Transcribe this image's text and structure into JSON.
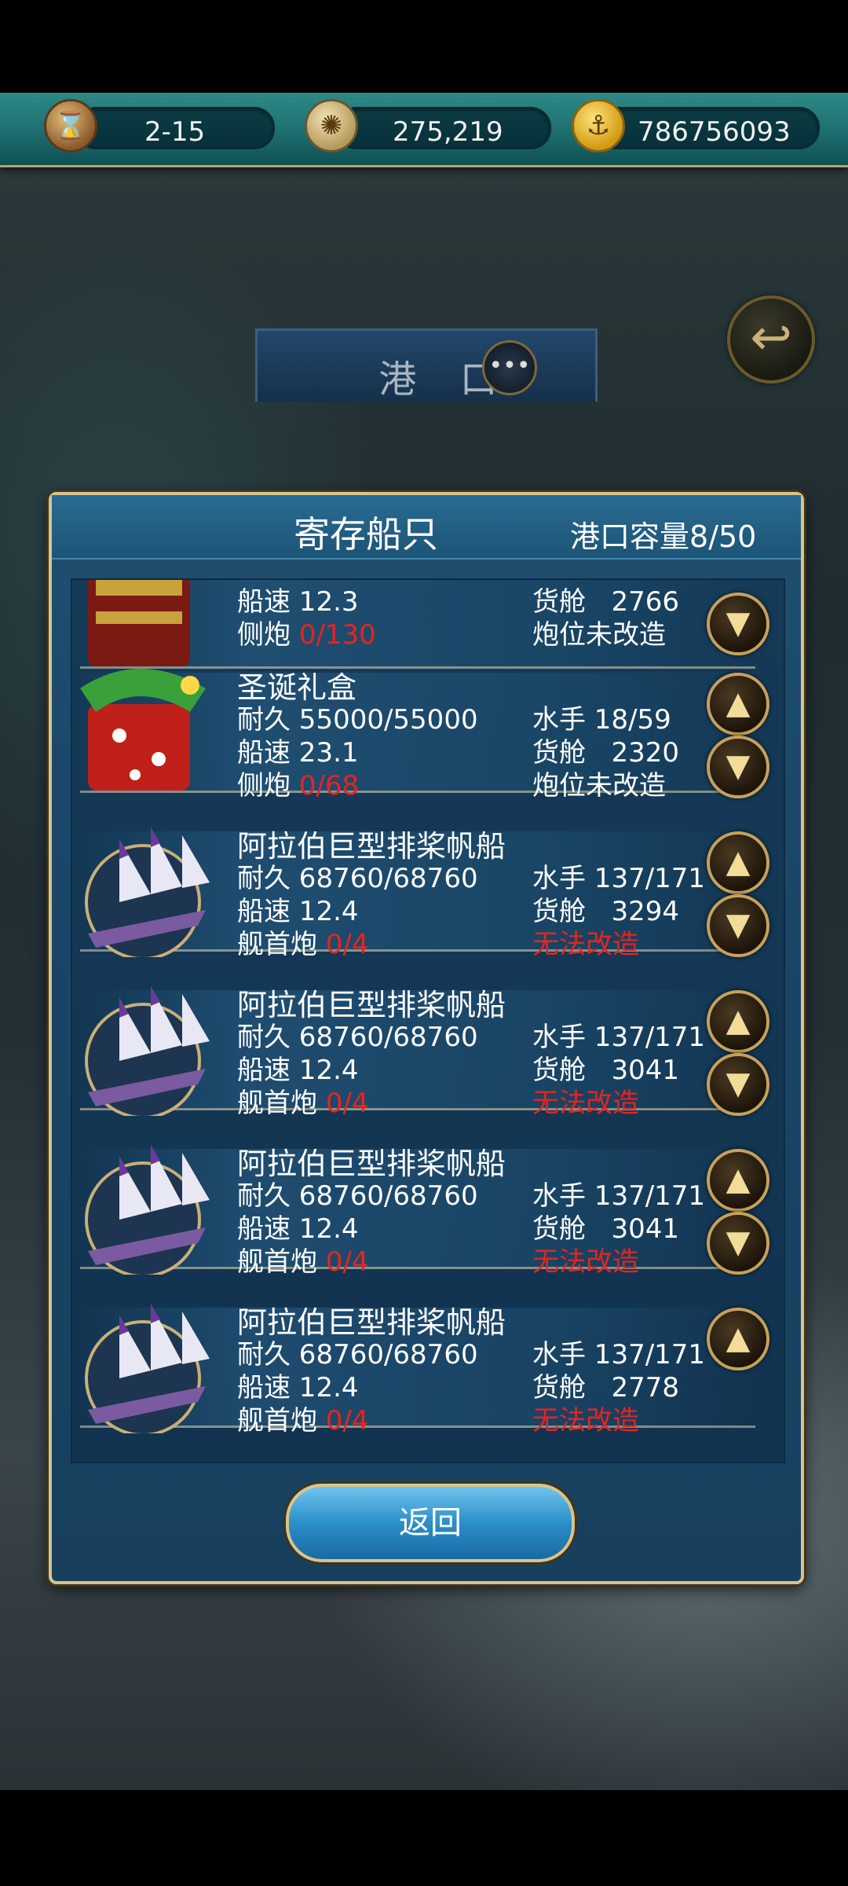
{
  "topbar": {
    "date": "2-15",
    "compass_value": "275,219",
    "gold": "786756093",
    "icons": [
      "hourglass-icon",
      "compass-icon",
      "anchor-coin-icon"
    ]
  },
  "port_title": "港 口",
  "panel": {
    "title": "寄存船只",
    "capacity_label": "港口容量",
    "capacity_value": "8/50"
  },
  "ships": [
    {
      "name": "",
      "durability": "",
      "sailors": "",
      "speed": "船速 12.3",
      "cargo_label": "货舱",
      "cargo": "2766",
      "gun_label": "侧炮",
      "gun": "0/130",
      "refit": "炮位未改造",
      "refit_red": false,
      "icon": "junk-ship-icon"
    },
    {
      "name": "圣诞礼盒",
      "durability": "耐久 55000/55000",
      "sailors": "水手 18/59",
      "speed": "船速 23.1",
      "cargo_label": "货舱",
      "cargo": "2320",
      "gun_label": "侧炮",
      "gun": "0/68",
      "refit": "炮位未改造",
      "refit_red": false,
      "icon": "gift-box-ship-icon"
    },
    {
      "name": "阿拉伯巨型排桨帆船",
      "durability": "耐久 68760/68760",
      "sailors": "水手 137/171",
      "speed": "船速 12.4",
      "cargo_label": "货舱",
      "cargo": "3294",
      "gun_label": "舰首炮",
      "gun": "0/4",
      "refit": "无法改造",
      "refit_red": true,
      "icon": "galley-ship-icon"
    },
    {
      "name": "阿拉伯巨型排桨帆船",
      "durability": "耐久 68760/68760",
      "sailors": "水手 137/171",
      "speed": "船速 12.4",
      "cargo_label": "货舱",
      "cargo": "3041",
      "gun_label": "舰首炮",
      "gun": "0/4",
      "refit": "无法改造",
      "refit_red": true,
      "icon": "galley-ship-icon"
    },
    {
      "name": "阿拉伯巨型排桨帆船",
      "durability": "耐久 68760/68760",
      "sailors": "水手 137/171",
      "speed": "船速 12.4",
      "cargo_label": "货舱",
      "cargo": "3041",
      "gun_label": "舰首炮",
      "gun": "0/4",
      "refit": "无法改造",
      "refit_red": true,
      "icon": "galley-ship-icon"
    },
    {
      "name": "阿拉伯巨型排桨帆船",
      "durability": "耐久 68760/68760",
      "sailors": "水手 137/171",
      "speed": "船速 12.4",
      "cargo_label": "货舱",
      "cargo": "2778",
      "gun_label": "舰首炮",
      "gun": "0/4",
      "refit": "无法改造",
      "refit_red": true,
      "icon": "galley-ship-icon"
    }
  ],
  "return_label": "返回",
  "colors": {
    "accent_gold": "#d8c48c",
    "warning_red": "#e8231f",
    "panel_blue": "#1a4566"
  }
}
